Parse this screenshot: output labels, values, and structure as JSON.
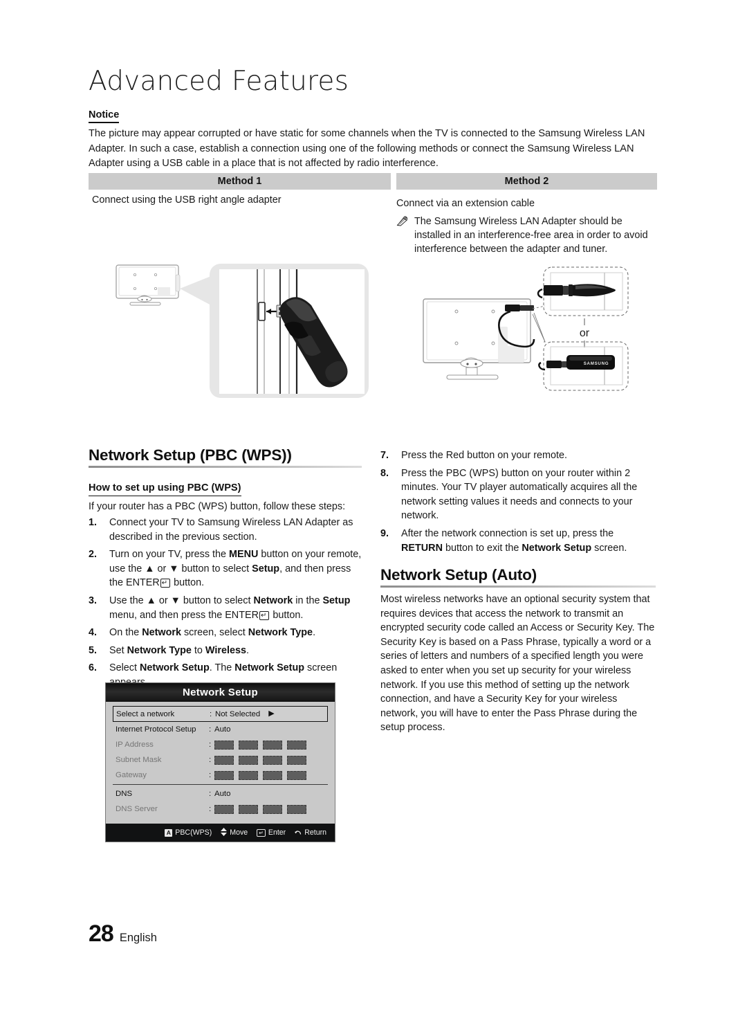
{
  "header": {
    "chapter_title": "Advanced Features"
  },
  "notice": {
    "label": "Notice",
    "body": "The picture may appear corrupted or have static for some channels when the TV is connected to the Samsung Wireless LAN Adapter. In such a case, establish a connection using one of the following methods or connect the Samsung Wireless LAN Adapter using a USB cable in a place that is not affected by radio interference."
  },
  "methods": {
    "method1": {
      "header": "Method 1",
      "caption": "Connect using the USB right angle adapter"
    },
    "method2": {
      "header": "Method 2",
      "caption": "Connect via an extension cable",
      "note": "The Samsung Wireless LAN Adapter should be installed in an interference-free area in order to avoid interference between the adapter and tuner.",
      "or_label": "or",
      "adapter_brand": "SAMSUNG"
    }
  },
  "pbc_section": {
    "heading": "Network Setup (PBC (WPS))",
    "sub_heading": "How to set up using PBC (WPS)",
    "lead": "If your router has a PBC (WPS) button, follow these steps:",
    "steps": [
      {
        "num": "1.",
        "html": "Connect your TV to Samsung Wireless LAN Adapter as described in the previous section."
      },
      {
        "num": "2.",
        "html": "Turn on your TV, press the <b>MENU</b> button on your remote, use the ▲ or ▼ button to select <b>Setup</b>, and then press the ENTER<span class=\"ent\">↵</span> button."
      },
      {
        "num": "3.",
        "html": "Use the ▲ or ▼ button to select <b>Network</b> in the <b>Setup</b> menu, and then press the ENTER<span class=\"ent\">↵</span> button."
      },
      {
        "num": "4.",
        "html": "On the <b>Network</b> screen, select <b>Network Type</b>."
      },
      {
        "num": "5.",
        "html": "Set <b>Network Type</b> to <b>Wireless</b>."
      },
      {
        "num": "6.",
        "html": "Select <b>Network Setup</b>. The <b>Network Setup</b> screen appears."
      },
      {
        "num": "7.",
        "html": "Press the Red button on your remote."
      },
      {
        "num": "8.",
        "html": "Press the PBC (WPS) button on your router within 2 minutes. Your TV player automatically acquires all the network setting values it needs and connects to your network."
      },
      {
        "num": "9.",
        "html": "After the network connection is set up, press the <b>RETURN</b> button to exit the <b>Network Setup</b> screen."
      }
    ]
  },
  "auto_section": {
    "heading": "Network Setup (Auto)",
    "paragraph": "Most wireless networks have an optional security system that requires devices that access the network to transmit an encrypted security code called an Access or Security Key. The Security Key is based on a Pass Phrase, typically a word or a series of letters and numbers of a specified length you were asked to enter when you set up security for your wireless network.  If you use this method of setting up the network connection, and have a Security Key for your wireless network, you will have to enter the Pass Phrase during the setup process."
  },
  "osd": {
    "title": "Network Setup",
    "rows": [
      {
        "label": "Select a network",
        "value": "Not Selected",
        "type": "text",
        "selected": true,
        "dim": false,
        "arrow": true
      },
      {
        "label": "Internet Protocol Setup",
        "value": "Auto",
        "type": "text",
        "selected": false,
        "dim": false,
        "arrow": false
      },
      {
        "label": "IP Address",
        "value": "",
        "type": "boxes",
        "selected": false,
        "dim": true,
        "arrow": false
      },
      {
        "label": "Subnet Mask",
        "value": "",
        "type": "boxes",
        "selected": false,
        "dim": true,
        "arrow": false
      },
      {
        "label": "Gateway",
        "value": "",
        "type": "boxes",
        "selected": false,
        "dim": true,
        "arrow": false
      },
      {
        "label": "DNS",
        "value": "Auto",
        "type": "text",
        "selected": false,
        "dim": false,
        "arrow": false,
        "divider_before": true
      },
      {
        "label": "DNS Server",
        "value": "",
        "type": "boxes",
        "selected": false,
        "dim": true,
        "arrow": false
      }
    ],
    "footer_keys": [
      {
        "icon": "A",
        "label": "PBC(WPS)"
      },
      {
        "icon": "updown",
        "label": "Move"
      },
      {
        "icon": "enter",
        "label": "Enter"
      },
      {
        "icon": "return",
        "label": "Return"
      }
    ]
  },
  "footer": {
    "page_number": "28",
    "language": "English"
  },
  "colors": {
    "method_header_bg": "#cbcbcb",
    "osd_bg": "#c9c9c9",
    "osd_title_bg": "#141414",
    "rule": "#8d8d8d"
  }
}
